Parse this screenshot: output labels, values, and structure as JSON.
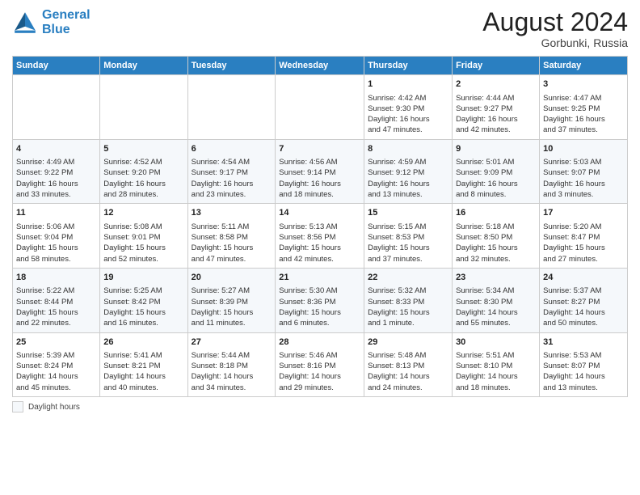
{
  "header": {
    "logo_line1": "General",
    "logo_line2": "Blue",
    "month_year": "August 2024",
    "location": "Gorbunki, Russia"
  },
  "legend": {
    "box_label": "Daylight hours"
  },
  "columns": [
    "Sunday",
    "Monday",
    "Tuesday",
    "Wednesday",
    "Thursday",
    "Friday",
    "Saturday"
  ],
  "rows": [
    [
      {
        "day": "",
        "text": ""
      },
      {
        "day": "",
        "text": ""
      },
      {
        "day": "",
        "text": ""
      },
      {
        "day": "",
        "text": ""
      },
      {
        "day": "1",
        "text": "Sunrise: 4:42 AM\nSunset: 9:30 PM\nDaylight: 16 hours\nand 47 minutes."
      },
      {
        "day": "2",
        "text": "Sunrise: 4:44 AM\nSunset: 9:27 PM\nDaylight: 16 hours\nand 42 minutes."
      },
      {
        "day": "3",
        "text": "Sunrise: 4:47 AM\nSunset: 9:25 PM\nDaylight: 16 hours\nand 37 minutes."
      }
    ],
    [
      {
        "day": "4",
        "text": "Sunrise: 4:49 AM\nSunset: 9:22 PM\nDaylight: 16 hours\nand 33 minutes."
      },
      {
        "day": "5",
        "text": "Sunrise: 4:52 AM\nSunset: 9:20 PM\nDaylight: 16 hours\nand 28 minutes."
      },
      {
        "day": "6",
        "text": "Sunrise: 4:54 AM\nSunset: 9:17 PM\nDaylight: 16 hours\nand 23 minutes."
      },
      {
        "day": "7",
        "text": "Sunrise: 4:56 AM\nSunset: 9:14 PM\nDaylight: 16 hours\nand 18 minutes."
      },
      {
        "day": "8",
        "text": "Sunrise: 4:59 AM\nSunset: 9:12 PM\nDaylight: 16 hours\nand 13 minutes."
      },
      {
        "day": "9",
        "text": "Sunrise: 5:01 AM\nSunset: 9:09 PM\nDaylight: 16 hours\nand 8 minutes."
      },
      {
        "day": "10",
        "text": "Sunrise: 5:03 AM\nSunset: 9:07 PM\nDaylight: 16 hours\nand 3 minutes."
      }
    ],
    [
      {
        "day": "11",
        "text": "Sunrise: 5:06 AM\nSunset: 9:04 PM\nDaylight: 15 hours\nand 58 minutes."
      },
      {
        "day": "12",
        "text": "Sunrise: 5:08 AM\nSunset: 9:01 PM\nDaylight: 15 hours\nand 52 minutes."
      },
      {
        "day": "13",
        "text": "Sunrise: 5:11 AM\nSunset: 8:58 PM\nDaylight: 15 hours\nand 47 minutes."
      },
      {
        "day": "14",
        "text": "Sunrise: 5:13 AM\nSunset: 8:56 PM\nDaylight: 15 hours\nand 42 minutes."
      },
      {
        "day": "15",
        "text": "Sunrise: 5:15 AM\nSunset: 8:53 PM\nDaylight: 15 hours\nand 37 minutes."
      },
      {
        "day": "16",
        "text": "Sunrise: 5:18 AM\nSunset: 8:50 PM\nDaylight: 15 hours\nand 32 minutes."
      },
      {
        "day": "17",
        "text": "Sunrise: 5:20 AM\nSunset: 8:47 PM\nDaylight: 15 hours\nand 27 minutes."
      }
    ],
    [
      {
        "day": "18",
        "text": "Sunrise: 5:22 AM\nSunset: 8:44 PM\nDaylight: 15 hours\nand 22 minutes."
      },
      {
        "day": "19",
        "text": "Sunrise: 5:25 AM\nSunset: 8:42 PM\nDaylight: 15 hours\nand 16 minutes."
      },
      {
        "day": "20",
        "text": "Sunrise: 5:27 AM\nSunset: 8:39 PM\nDaylight: 15 hours\nand 11 minutes."
      },
      {
        "day": "21",
        "text": "Sunrise: 5:30 AM\nSunset: 8:36 PM\nDaylight: 15 hours\nand 6 minutes."
      },
      {
        "day": "22",
        "text": "Sunrise: 5:32 AM\nSunset: 8:33 PM\nDaylight: 15 hours\nand 1 minute."
      },
      {
        "day": "23",
        "text": "Sunrise: 5:34 AM\nSunset: 8:30 PM\nDaylight: 14 hours\nand 55 minutes."
      },
      {
        "day": "24",
        "text": "Sunrise: 5:37 AM\nSunset: 8:27 PM\nDaylight: 14 hours\nand 50 minutes."
      }
    ],
    [
      {
        "day": "25",
        "text": "Sunrise: 5:39 AM\nSunset: 8:24 PM\nDaylight: 14 hours\nand 45 minutes."
      },
      {
        "day": "26",
        "text": "Sunrise: 5:41 AM\nSunset: 8:21 PM\nDaylight: 14 hours\nand 40 minutes."
      },
      {
        "day": "27",
        "text": "Sunrise: 5:44 AM\nSunset: 8:18 PM\nDaylight: 14 hours\nand 34 minutes."
      },
      {
        "day": "28",
        "text": "Sunrise: 5:46 AM\nSunset: 8:16 PM\nDaylight: 14 hours\nand 29 minutes."
      },
      {
        "day": "29",
        "text": "Sunrise: 5:48 AM\nSunset: 8:13 PM\nDaylight: 14 hours\nand 24 minutes."
      },
      {
        "day": "30",
        "text": "Sunrise: 5:51 AM\nSunset: 8:10 PM\nDaylight: 14 hours\nand 18 minutes."
      },
      {
        "day": "31",
        "text": "Sunrise: 5:53 AM\nSunset: 8:07 PM\nDaylight: 14 hours\nand 13 minutes."
      }
    ]
  ]
}
